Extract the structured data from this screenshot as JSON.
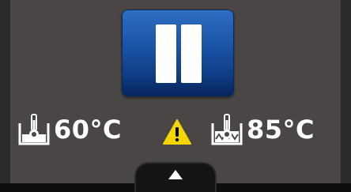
{
  "controls": {
    "pause_button": {
      "icon": "pause-icon",
      "color": "#1c55a8"
    },
    "expand_button": {
      "icon": "chevron-up-icon"
    }
  },
  "left_temperature": {
    "icon": "tank-thermometer-icon",
    "value": "60°C"
  },
  "right_temperature": {
    "icon": "heating-tank-thermometer-icon",
    "value": "85°C"
  },
  "warning": {
    "icon": "warning-icon",
    "color": "#f5d500"
  }
}
